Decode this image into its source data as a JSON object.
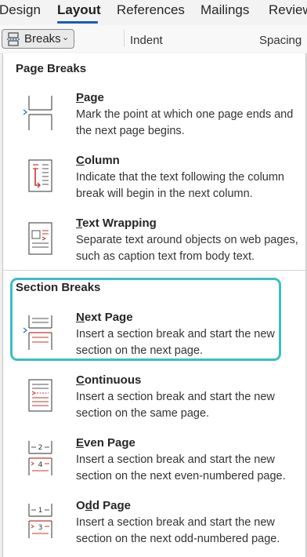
{
  "ribbon": {
    "tabs": [
      {
        "label": "Design"
      },
      {
        "label": "Layout"
      },
      {
        "label": "References"
      },
      {
        "label": "Mailings"
      },
      {
        "label": "Review"
      }
    ],
    "active_tab": "Layout",
    "breaks_button": {
      "label": "Breaks",
      "icon": "breaks-icon",
      "chevron": "chevron-down-icon"
    },
    "indent_label": "Indent",
    "spacing_label": "Spacing"
  },
  "menu": {
    "page_breaks_heading": "Page Breaks",
    "section_breaks_heading": "Section Breaks",
    "items": [
      {
        "key": "P",
        "rest": "age",
        "description": "Mark the point at which one page ends and the next page begins.",
        "icon": "page-break-icon"
      },
      {
        "key": "C",
        "rest": "olumn",
        "description": "Indicate that the text following the column break will begin in the next column.",
        "icon": "column-break-icon"
      },
      {
        "key": "T",
        "rest": "ext Wrapping",
        "description": "Separate text around objects on web pages, such as caption text from body text.",
        "icon": "text-wrapping-icon"
      },
      {
        "key": "N",
        "rest": "ext Page",
        "description": "Insert a section break and start the new section on the next page.",
        "icon": "next-page-section-icon"
      },
      {
        "key": "C",
        "rest": "ontinuous",
        "description": "Insert a section break and start the new section on the same page.",
        "icon": "continuous-section-icon"
      },
      {
        "key": "E",
        "rest": "ven Page",
        "description": "Insert a section break and start the new section on the next even-numbered page.",
        "icon": "even-page-section-icon"
      },
      {
        "key": "O",
        "pre": "O",
        "underline_char": "d",
        "post": "d Page",
        "description": "Insert a section break and start the new section on the next odd-numbered page.",
        "icon": "odd-page-section-icon"
      }
    ],
    "highlight_color": "#3bbfbf",
    "accent_color": "#c0392b"
  }
}
